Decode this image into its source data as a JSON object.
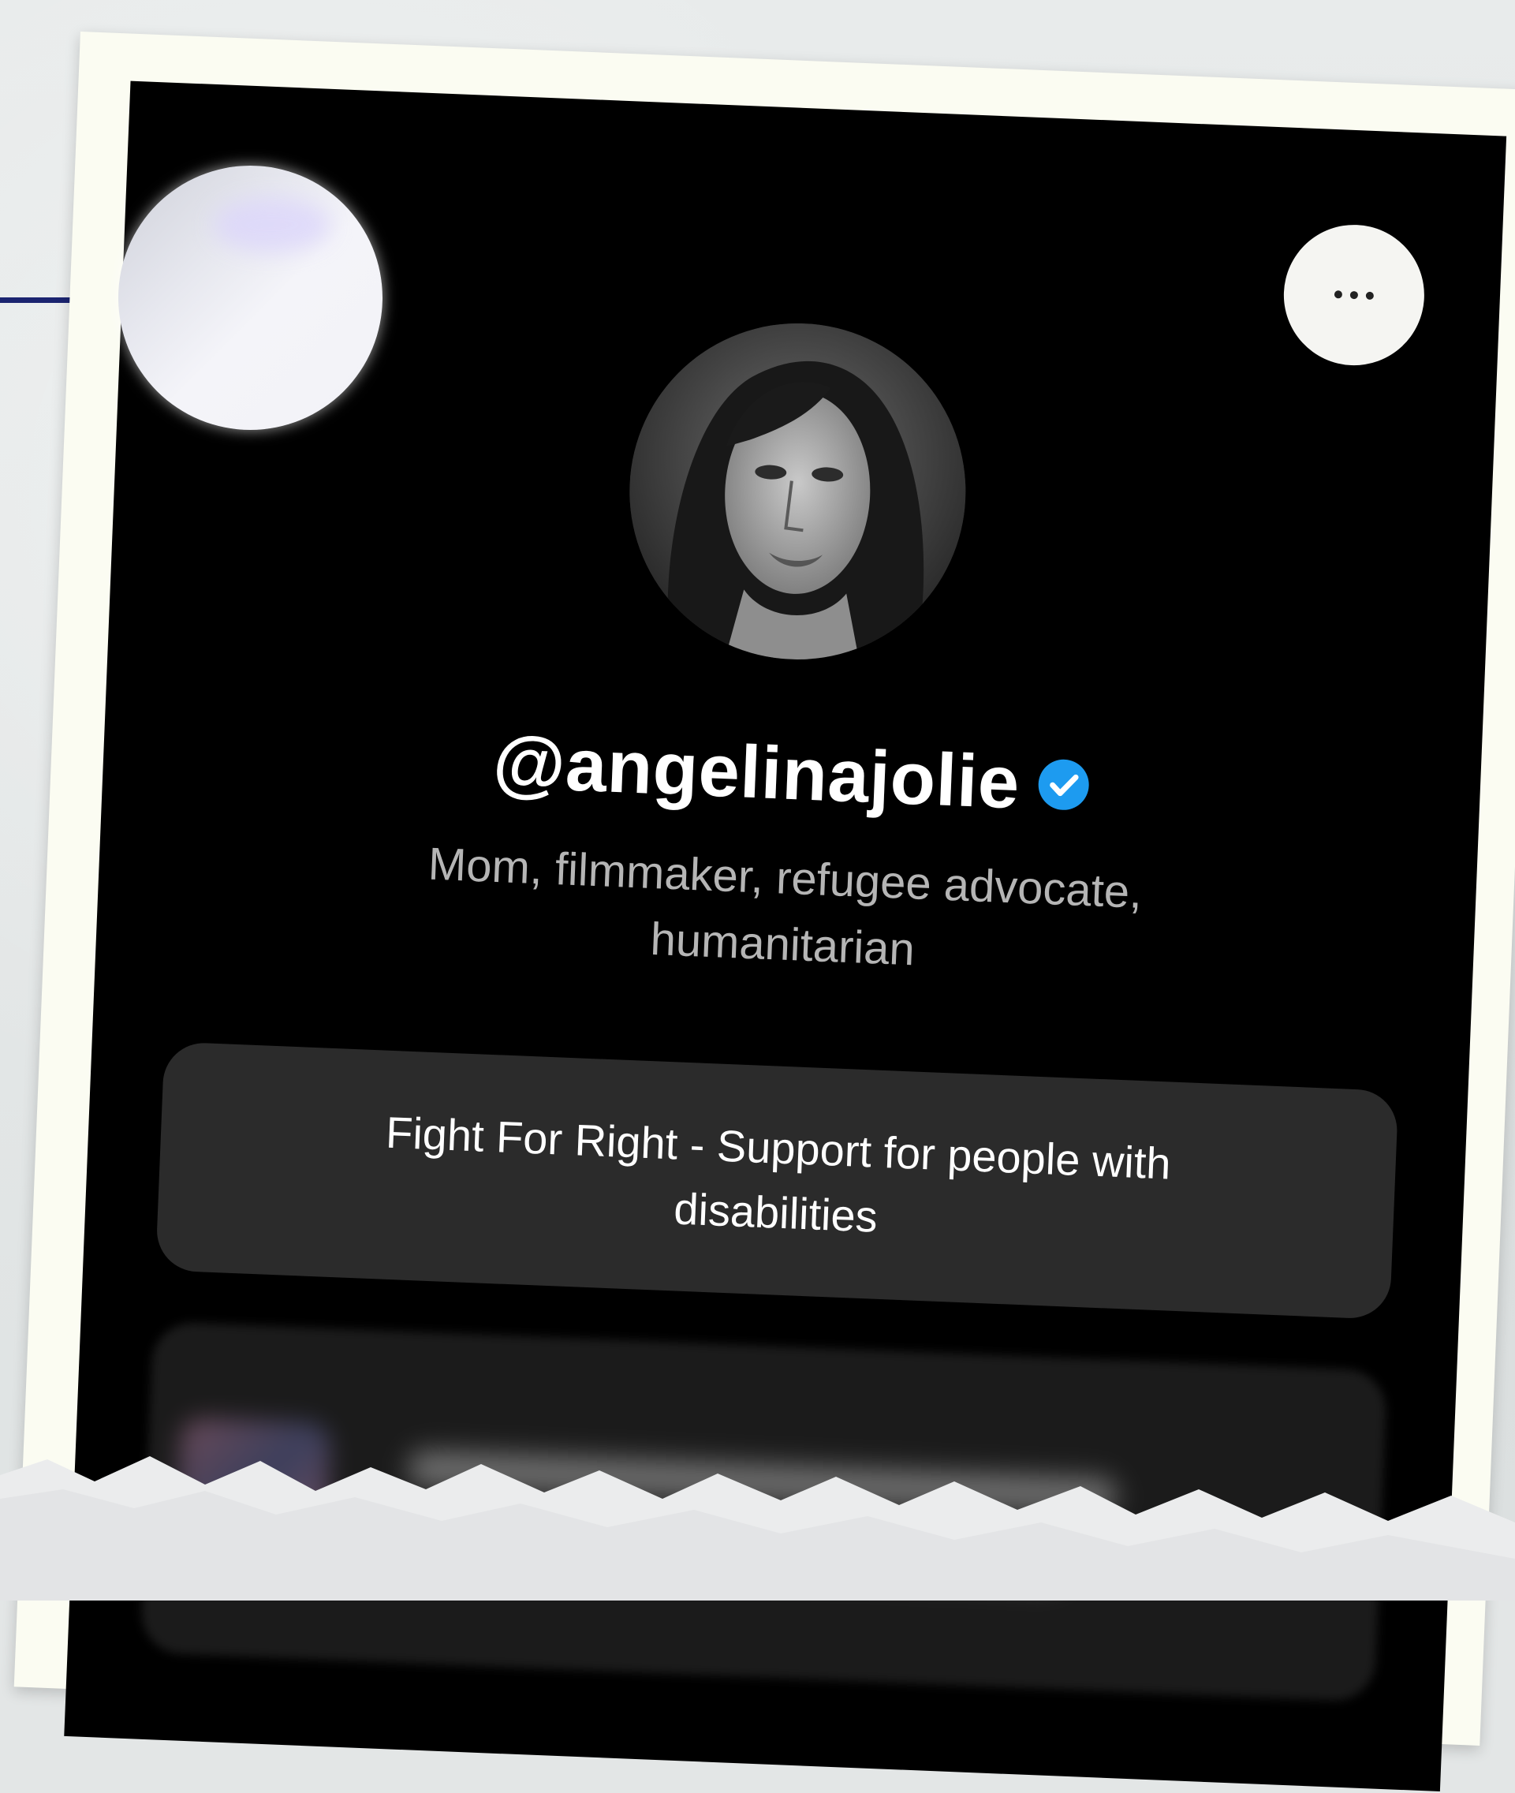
{
  "profile": {
    "username": "@angelinajolie",
    "verified": true,
    "bio": "Mom, filmmaker, refugee advocate, humanitarian",
    "avatar_icon": "profile-photo"
  },
  "header": {
    "more_icon": "more-horizontal-icon"
  },
  "links": [
    {
      "label": "Fight For Right - Support for people with disabilities"
    }
  ],
  "colors": {
    "screen_background": "#000000",
    "card_background": "#2b2b2b",
    "username_text": "#ffffff",
    "bio_text": "#b5b5b5",
    "verified_badge": "#1d9bf0",
    "frame": "#fbfcf2",
    "accent_line": "#1b2470"
  }
}
